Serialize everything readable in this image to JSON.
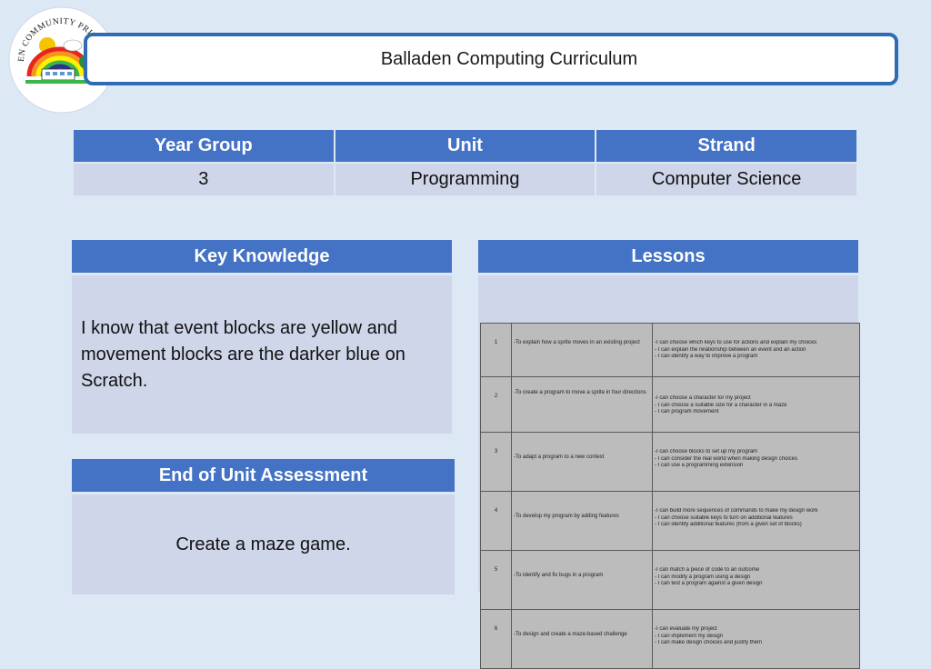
{
  "header": {
    "title": "Balladen Computing Curriculum",
    "logo_text": "BALLADEN COMMUNITY PRIMARY SCHOOL"
  },
  "info_table": {
    "headers": [
      "Year Group",
      "Unit",
      "Strand"
    ],
    "values": [
      "3",
      "Programming",
      "Computer Science"
    ]
  },
  "key_knowledge": {
    "heading": "Key Knowledge",
    "text": "I know that event blocks are yellow and movement blocks are the darker blue on Scratch."
  },
  "assessment": {
    "heading": "End of Unit Assessment",
    "text": "Create a maze game."
  },
  "lessons": {
    "heading": "Lessons",
    "rows": [
      {
        "num": "1",
        "objective": "-To explain how a sprite moves in an existing project",
        "outcomes": [
          "-I can choose which keys to use for actions and explain my choices",
          "- I can explain the relationship between an event and an action",
          "- I can identify a way to improve a program"
        ]
      },
      {
        "num": "2",
        "objective": "-To create a program to move a sprite in four directions",
        "outcomes": [
          "-I can choose a character for my project",
          "- I can choose a suitable size for a character in a maze",
          "- I can program movement"
        ]
      },
      {
        "num": "3",
        "objective": "-To adapt a program to a new context",
        "outcomes": [
          "-I can choose blocks to set up my program",
          "- I can consider the real world when making design choices",
          "- I can use a programming extension"
        ]
      },
      {
        "num": "4",
        "objective": "-To develop my program by adding features",
        "outcomes": [
          "-I can build more sequences of commands to make my design work",
          "- I can choose suitable keys to turn on additional features",
          "- I can identify additional features (from a given set of blocks)"
        ]
      },
      {
        "num": "5",
        "objective": "-To identify and fix bugs in a program",
        "outcomes": [
          "-I can match a piece of code to an outcome",
          "- I can modify a program using a design",
          "- I can test a program against a given design"
        ]
      },
      {
        "num": "6",
        "objective": "-To design and create a maze-based challenge",
        "outcomes": [
          "-I can evaluate my project",
          "- I can implement my design",
          "- I can make design choices and justify them"
        ]
      }
    ]
  }
}
